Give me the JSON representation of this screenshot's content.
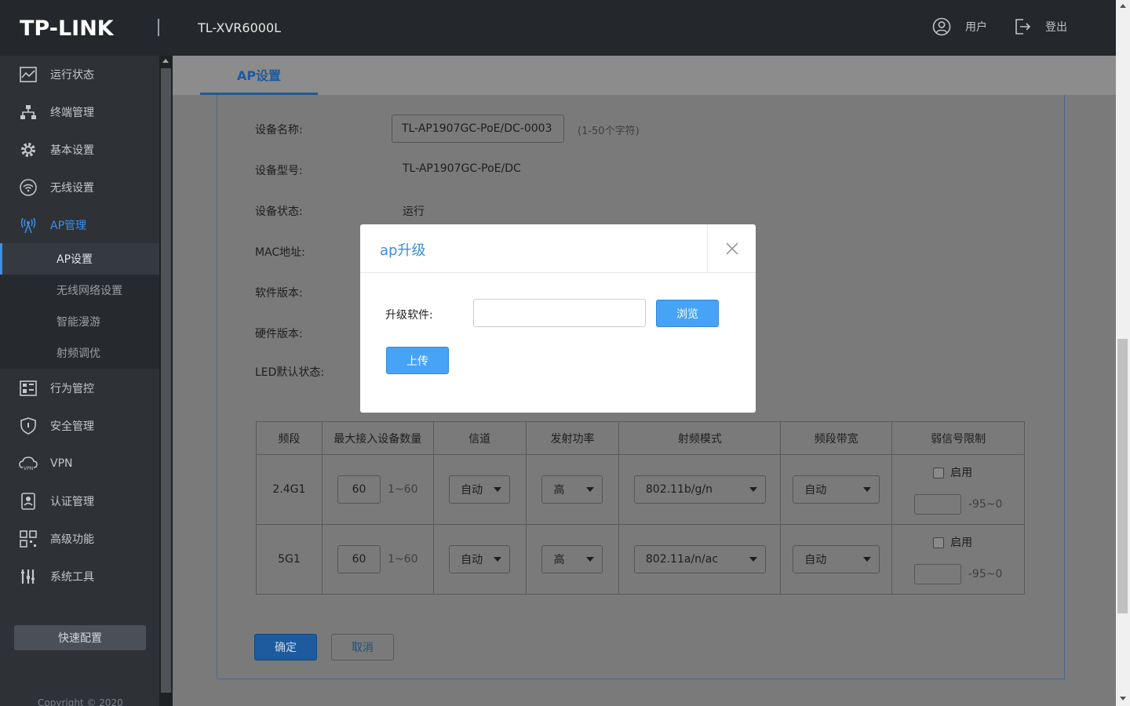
{
  "header": {
    "logo": "TP-LINK",
    "model": "TL-XVR6000L",
    "user_label": "用户",
    "logout_label": "登出"
  },
  "sidebar": {
    "items": [
      {
        "label": "运行状态",
        "icon": "chart-icon"
      },
      {
        "label": "终端管理",
        "icon": "network-tree-icon"
      },
      {
        "label": "基本设置",
        "icon": "gear-icon"
      },
      {
        "label": "无线设置",
        "icon": "wifi-icon"
      },
      {
        "label": "AP管理",
        "icon": "ap-broadcast-icon",
        "active": true
      },
      {
        "label": "行为管控",
        "icon": "monitor-control-icon"
      },
      {
        "label": "安全管理",
        "icon": "shield-icon"
      },
      {
        "label": "VPN",
        "icon": "vpn-cloud-icon"
      },
      {
        "label": "认证管理",
        "icon": "badge-icon"
      },
      {
        "label": "高级功能",
        "icon": "grid-icon"
      },
      {
        "label": "系统工具",
        "icon": "tools-icon"
      }
    ],
    "sub_items": [
      {
        "label": "AP设置",
        "active": true
      },
      {
        "label": "无线网络设置"
      },
      {
        "label": "智能漫游"
      },
      {
        "label": "射频调优"
      }
    ],
    "quick_config": "快速配置",
    "copyright": "Copyright © 2020"
  },
  "tab": {
    "label": "AP设置"
  },
  "form": {
    "device_name_label": "设备名称:",
    "device_name_value": "TL-AP1907GC-PoE/DC-0003",
    "device_name_hint": "(1-50个字符)",
    "device_model_label": "设备型号:",
    "device_model_value": "TL-AP1907GC-PoE/DC",
    "device_status_label": "设备状态:",
    "device_status_value": "运行",
    "mac_label": "MAC地址:",
    "software_label": "软件版本:",
    "hardware_label": "硬件版本:",
    "led_label": "LED默认状态:"
  },
  "radio_table": {
    "headers": [
      "频段",
      "最大接入设备数量",
      "信道",
      "发射功率",
      "射频模式",
      "频段带宽",
      "弱信号限制"
    ],
    "rows": [
      {
        "band": "2.4G1",
        "max_devices": "60",
        "range": "1~60",
        "channel": "自动",
        "power": "高",
        "mode": "802.11b/g/n",
        "bandwidth": "自动",
        "enable_label": "启用",
        "signal_range": "-95~0"
      },
      {
        "band": "5G1",
        "max_devices": "60",
        "range": "1~60",
        "channel": "自动",
        "power": "高",
        "mode": "802.11a/n/ac",
        "bandwidth": "自动",
        "enable_label": "启用",
        "signal_range": "-95~0"
      }
    ]
  },
  "buttons": {
    "ok": "确定",
    "cancel": "取消"
  },
  "modal": {
    "title": "ap升级",
    "upgrade_label": "升级软件:",
    "browse": "浏览",
    "upload": "上传"
  },
  "colors": {
    "accent": "#3b8fe8",
    "modal_button": "#47a3f5",
    "header_bg": "#24272b",
    "sidebar_bg": "#2e3237"
  }
}
